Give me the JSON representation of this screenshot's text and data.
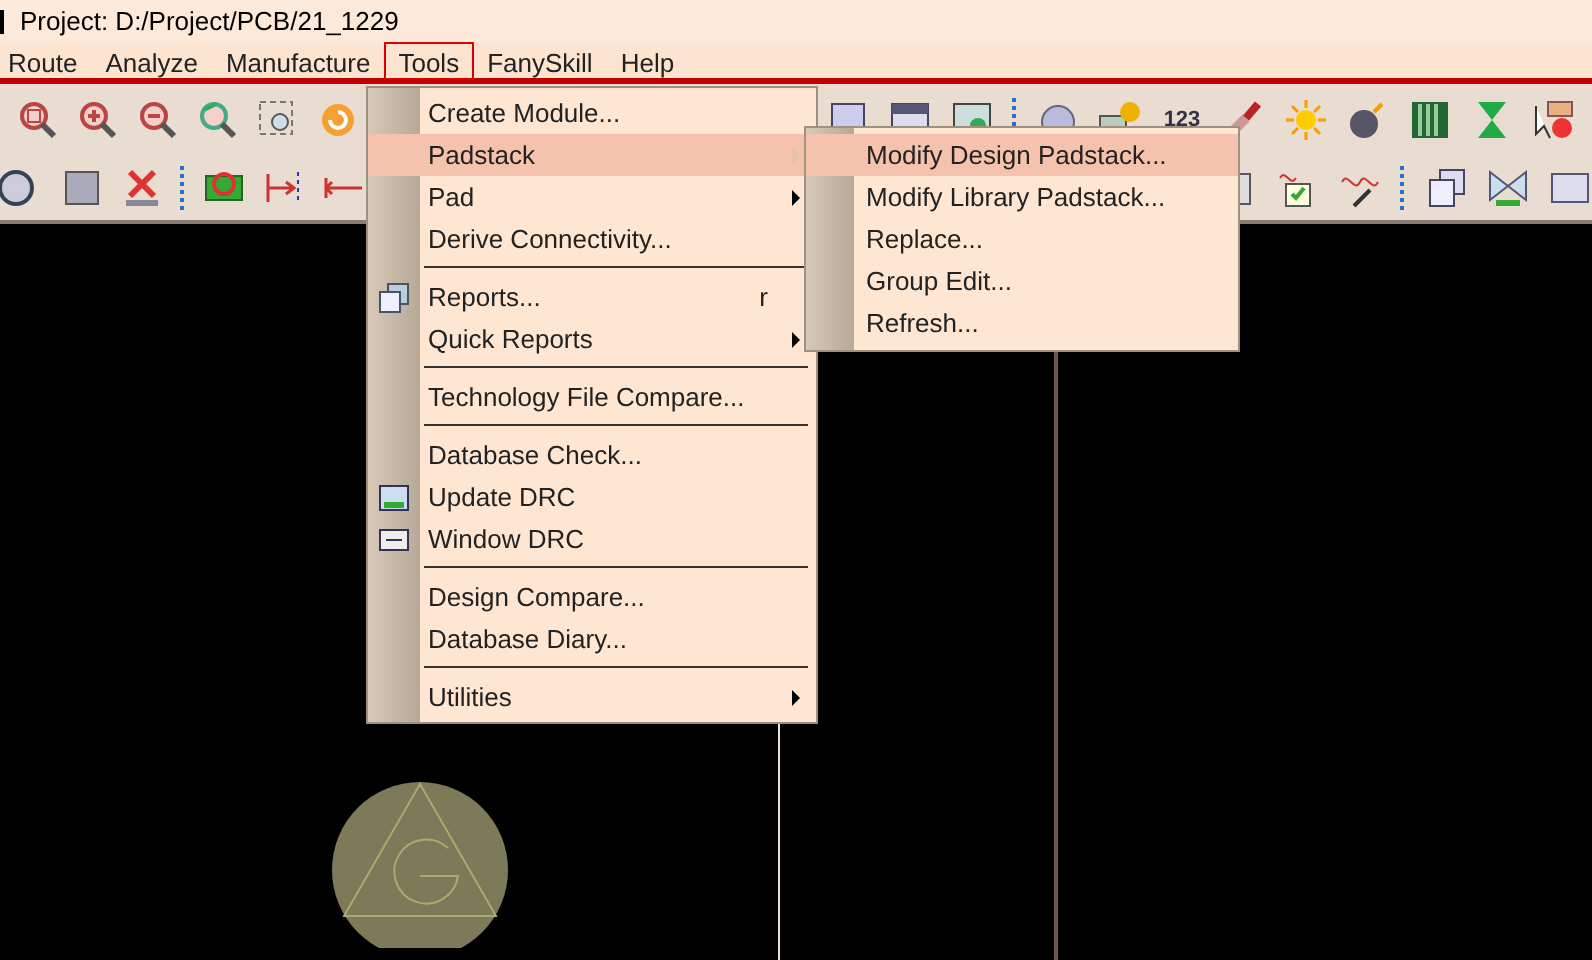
{
  "window": {
    "title": "Project: D:/Project/PCB/21_1229"
  },
  "menubar": [
    {
      "label": "Route",
      "selected": false
    },
    {
      "label": "Analyze",
      "selected": false
    },
    {
      "label": "Manufacture",
      "selected": false
    },
    {
      "label": "Tools",
      "selected": true
    },
    {
      "label": "FanySkill",
      "selected": false
    },
    {
      "label": "Help",
      "selected": false
    }
  ],
  "toolbar_text": "123",
  "tools_menu": [
    {
      "kind": "item",
      "label": "Create Module...",
      "selected": false,
      "submenu": false
    },
    {
      "kind": "item",
      "label": "Padstack",
      "selected": true,
      "submenu": true
    },
    {
      "kind": "item",
      "label": "Pad",
      "selected": false,
      "submenu": true
    },
    {
      "kind": "item",
      "label": "Derive Connectivity...",
      "selected": false,
      "submenu": false
    },
    {
      "kind": "separator"
    },
    {
      "kind": "item",
      "label": "Reports...",
      "shortcut": "r",
      "selected": false,
      "submenu": false
    },
    {
      "kind": "item",
      "label": "Quick Reports",
      "selected": false,
      "submenu": true
    },
    {
      "kind": "separator"
    },
    {
      "kind": "item",
      "label": "Technology File Compare...",
      "selected": false,
      "submenu": false
    },
    {
      "kind": "separator"
    },
    {
      "kind": "item",
      "label": "Database Check...",
      "selected": false,
      "submenu": false
    },
    {
      "kind": "item",
      "label": "Update DRC",
      "selected": false,
      "submenu": false
    },
    {
      "kind": "item",
      "label": "Window DRC",
      "selected": false,
      "submenu": false
    },
    {
      "kind": "separator"
    },
    {
      "kind": "item",
      "label": "Design Compare...",
      "selected": false,
      "submenu": false
    },
    {
      "kind": "item",
      "label": "Database Diary...",
      "selected": false,
      "submenu": false
    },
    {
      "kind": "separator"
    },
    {
      "kind": "item",
      "label": "Utilities",
      "selected": false,
      "submenu": true
    }
  ],
  "padstack_submenu": [
    {
      "label": "Modify Design Padstack...",
      "selected": true
    },
    {
      "label": "Modify Library Padstack...",
      "selected": false
    },
    {
      "label": "Replace...",
      "selected": false
    },
    {
      "label": "Group Edit...",
      "selected": false
    },
    {
      "label": "Refresh...",
      "selected": false
    }
  ]
}
